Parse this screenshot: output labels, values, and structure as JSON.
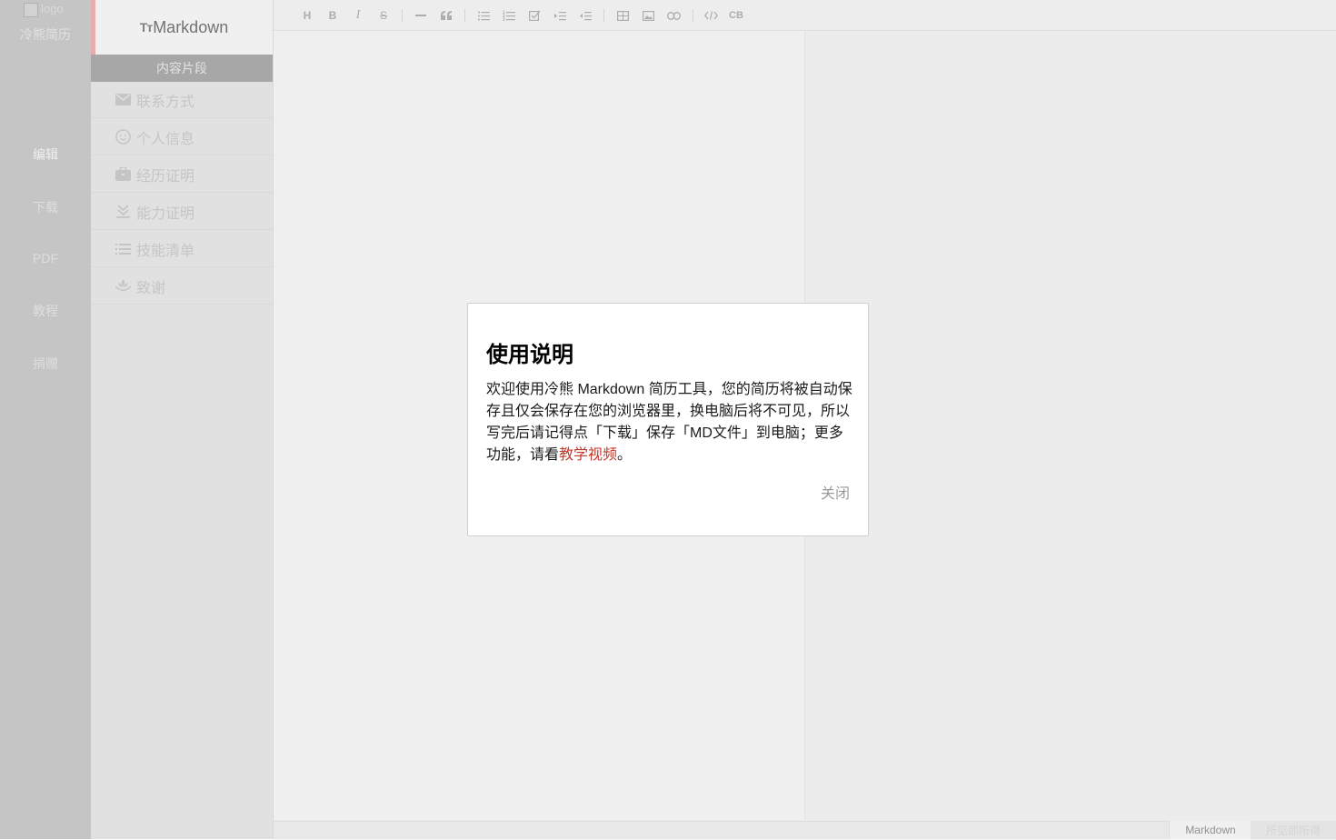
{
  "leftnav": {
    "logo_alt": "logo",
    "brand": "冷熊简历",
    "items": [
      {
        "label": "编辑",
        "active": true
      },
      {
        "label": "下载",
        "active": false
      },
      {
        "label": "PDF",
        "active": false
      },
      {
        "label": "教程",
        "active": false
      },
      {
        "label": "捐赠",
        "active": false
      }
    ]
  },
  "panel": {
    "title_prefix": "Tт",
    "title": "Markdown",
    "subtitle": "内容片段",
    "snippets": [
      {
        "label": "联系方式",
        "icon": "mail-icon"
      },
      {
        "label": "个人信息",
        "icon": "smile-icon"
      },
      {
        "label": "经历证明",
        "icon": "briefcase-icon"
      },
      {
        "label": "能力证明",
        "icon": "ability-icon"
      },
      {
        "label": "技能清单",
        "icon": "list-icon"
      },
      {
        "label": "致谢",
        "icon": "thanks-icon"
      }
    ]
  },
  "toolbar": {
    "heading": "H",
    "bold": "B",
    "italic": "I",
    "strike": "S",
    "cb": "CB"
  },
  "modal": {
    "title": "使用说明",
    "body_before": "欢迎使用冷熊 Markdown 简历工具，您的简历将被自动保存且仅会保存在您的浏览器里，换电脑后将不可见，所以写完后请记得点「下载」保存「MD文件」到电脑；更多功能，请看",
    "link": "教学视频",
    "body_after": "。",
    "close": "关闭"
  },
  "status": {
    "markdown": "Markdown",
    "wysiwyg": "所见即所得"
  },
  "colors": {
    "link": "#c0392b",
    "nav_bg": "#d2d2d2",
    "panel_sub_bg": "#b2b2b2"
  }
}
